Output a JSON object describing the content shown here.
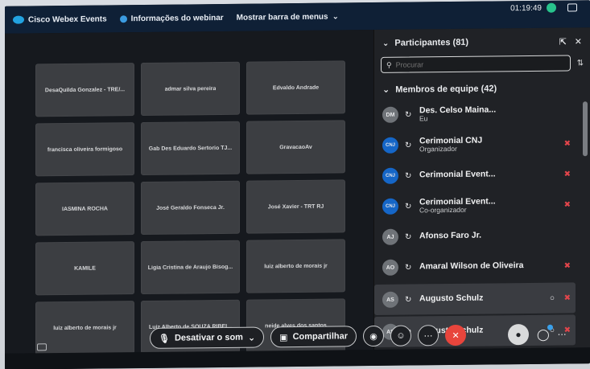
{
  "topbar": {
    "app_name": "Cisco Webex Events",
    "info_label": "Informações do webinar",
    "menu_toggle_label": "Mostrar barra de menus",
    "timer": "01:19:49"
  },
  "video_tiles": [
    "DesaQuilda Gonzalez - TRE/...",
    "admar silva pereira",
    "Edvaldo Andrade",
    "francisca oliveira formigoso",
    "Gab Des Eduardo Sertorio TJ...",
    "GravacaoAv",
    "IASMINA ROCHA",
    "José Geraldo Fonseca Jr.",
    "José Xavier - TRT RJ",
    "KAMILE",
    "Ligia Cristina de Araujo Bisog...",
    "luiz alberto de morais jr",
    "luiz alberto de morais jr",
    "Luiz Alberto de SOUZA RIBEI...",
    "neide alves dos santos"
  ],
  "panel": {
    "title": "Participantes (81)",
    "search_placeholder": "Procurar",
    "section_title": "Membros de equipe (42)",
    "participants": [
      {
        "initials": "DM",
        "name": "Des. Celso Maina...",
        "role": "Eu",
        "muted": false,
        "chat": false,
        "cnj": false
      },
      {
        "initials": "CNJ",
        "name": "Cerimonial CNJ",
        "role": "Organizador",
        "muted": true,
        "chat": false,
        "cnj": true
      },
      {
        "initials": "CNJ",
        "name": "Cerimonial Event...",
        "role": "",
        "muted": true,
        "chat": false,
        "cnj": true
      },
      {
        "initials": "CNJ",
        "name": "Cerimonial Event...",
        "role": "Co-organizador",
        "muted": true,
        "chat": false,
        "cnj": true
      },
      {
        "initials": "AJ",
        "name": "Afonso Faro Jr.",
        "role": "",
        "muted": false,
        "chat": false,
        "cnj": false
      },
      {
        "initials": "AO",
        "name": "Amaral Wilson de Oliveira",
        "role": "",
        "muted": true,
        "chat": false,
        "cnj": false
      },
      {
        "initials": "AS",
        "name": "Augusto Schulz",
        "role": "",
        "muted": true,
        "chat": true,
        "cnj": false,
        "highlight": true
      },
      {
        "initials": "AS",
        "name": "Augusto Schulz",
        "role": "",
        "muted": true,
        "chat": true,
        "cnj": false,
        "highlight": true
      }
    ]
  },
  "controls": {
    "mute_label": "Desativar o som",
    "share_label": "Compartilhar"
  },
  "colors": {
    "end_call": "#e8453c",
    "muted_mic": "#e3454b",
    "timer_dot": "#28c38c",
    "cnj_avatar": "#1566c7"
  }
}
